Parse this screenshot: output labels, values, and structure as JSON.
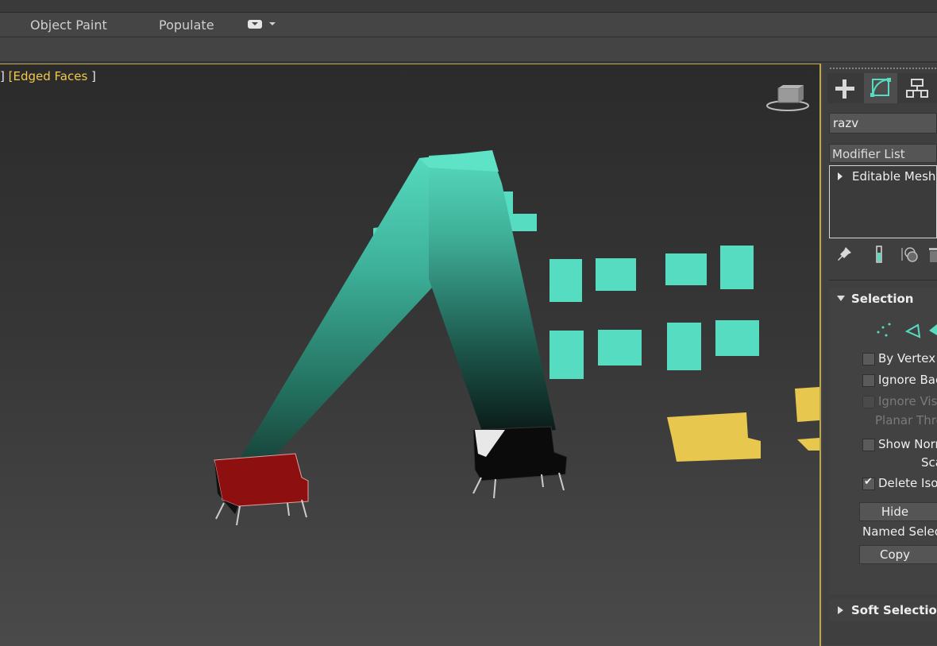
{
  "ribbon": {
    "tabs": [
      {
        "label": "Object Paint"
      },
      {
        "label": "Populate"
      }
    ]
  },
  "viewport": {
    "label_fragment": "]",
    "label_edged": "[Edged Faces",
    "label_close": "]",
    "colors": {
      "teal": "#56dcc0",
      "yellow": "#e8c74f",
      "red_sofa": "#8e0f0f",
      "black_sofa": "#0b0b0b",
      "active_border": "#bca54a"
    }
  },
  "command_panel": {
    "tabs": [
      {
        "icon": "plus-icon"
      },
      {
        "icon": "modify-curve-icon"
      },
      {
        "icon": "hierarchy-icon"
      }
    ],
    "object_name": "razv",
    "modifier_list": "Modifier List",
    "stack": [
      {
        "label": "Editable Mesh"
      }
    ],
    "stack_tools": [
      {
        "icon": "pin-icon"
      },
      {
        "icon": "show-end-result-icon"
      },
      {
        "icon": "make-unique-icon"
      },
      {
        "icon": "remove-modifier-icon"
      }
    ],
    "selection": {
      "title": "Selection",
      "sub_icons": [
        {
          "icon": "vertex-icon"
        },
        {
          "icon": "edge-icon"
        },
        {
          "icon": "face-icon"
        }
      ],
      "by_vertex": "By Vertex",
      "ignore_backfacing": "Ignore Bac",
      "ignore_visible": "Ignore Visi",
      "planar_threshold": "Planar Thre",
      "show_normals": "Show Norm",
      "scale": "Sca",
      "delete_isolated": "Delete Isola",
      "hide_button": "Hide",
      "named_selections": "Named Select",
      "copy_button": "Copy"
    },
    "soft_selection": {
      "title": "Soft Selection"
    }
  }
}
